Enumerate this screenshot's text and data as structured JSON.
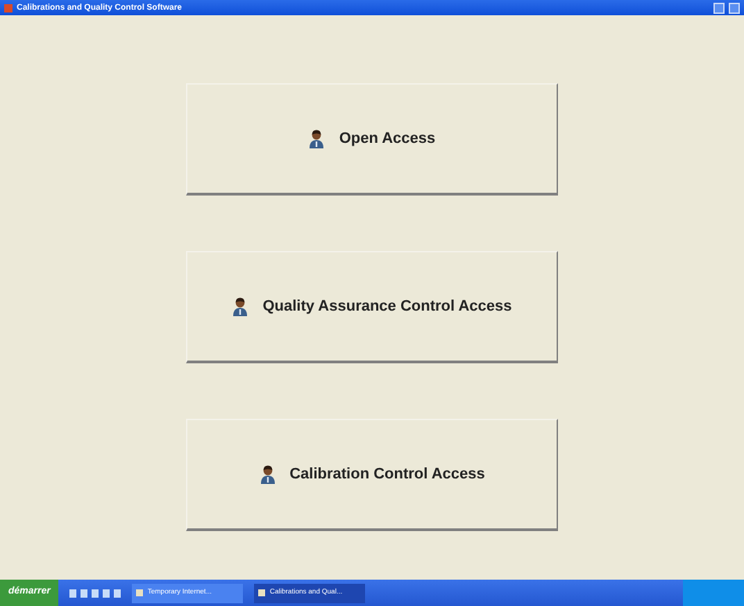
{
  "window": {
    "title": "Calibrations and Quality Control Software"
  },
  "buttons": [
    {
      "label": "Open Access"
    },
    {
      "label": "Quality Assurance Control Access"
    },
    {
      "label": "Calibration Control Access"
    }
  ],
  "taskbar": {
    "start": "démarrer",
    "tasks": [
      {
        "label": "Temporary Internet...",
        "selected": false
      },
      {
        "label": "Calibrations and Qual...",
        "selected": true
      }
    ]
  }
}
